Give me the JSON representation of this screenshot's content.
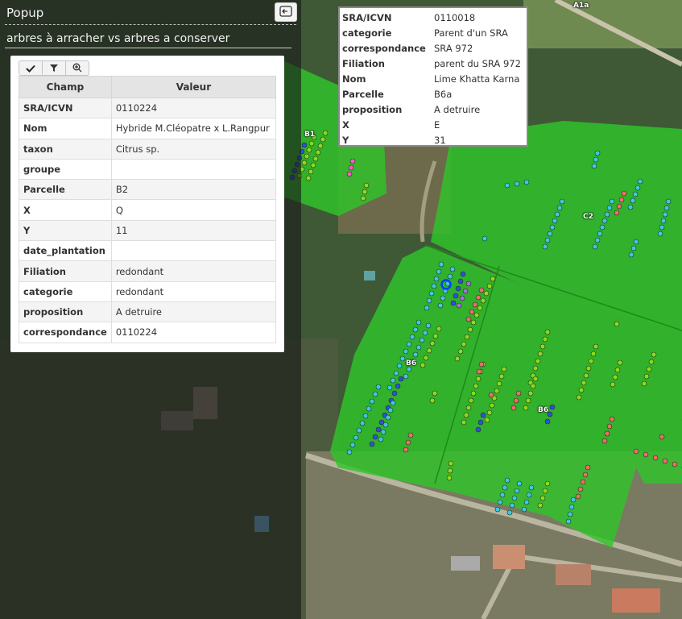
{
  "popup": {
    "title": "Popup",
    "close_icon": "collapse-left-icon",
    "layer_name": "arbres à arracher vs arbres a conserver",
    "toolbar": [
      {
        "name": "check-icon",
        "glyph": "✔"
      },
      {
        "name": "filter-icon",
        "glyph": "⏷"
      },
      {
        "name": "zoom-in-icon",
        "glyph": "⊕"
      }
    ],
    "table": {
      "headers": [
        "Champ",
        "Valeur"
      ],
      "rows": [
        [
          "SRA/ICVN",
          "0110224"
        ],
        [
          "Nom",
          "Hybride M.Cléopatre x L.Rangpur"
        ],
        [
          "taxon",
          "Citrus sp."
        ],
        [
          "groupe",
          ""
        ],
        [
          "Parcelle",
          "B2"
        ],
        [
          "X",
          "Q"
        ],
        [
          "Y",
          "11"
        ],
        [
          "date_plantation",
          ""
        ],
        [
          "Filiation",
          "redondant"
        ],
        [
          "categorie",
          "redondant"
        ],
        [
          "proposition",
          "A detruire"
        ],
        [
          "correspondance",
          "0110224"
        ]
      ]
    }
  },
  "tooltip": {
    "rows": [
      [
        "SRA/ICVN",
        "0110018"
      ],
      [
        "categorie",
        "Parent d'un SRA"
      ],
      [
        "correspondance",
        "SRA 972"
      ],
      [
        "Filiation",
        "parent du SRA 972"
      ],
      [
        "Nom",
        "Lime Khatta Karna"
      ],
      [
        "Parcelle",
        "B6a"
      ],
      [
        "proposition",
        "A detruire"
      ],
      [
        "X",
        "E"
      ],
      [
        "Y",
        "31"
      ]
    ]
  },
  "map": {
    "labels": [
      "A1a",
      "B1",
      "C2",
      "B6",
      "B6"
    ],
    "colors": {
      "parcel_fill": "#2fc42a",
      "cyan_tree": "#3ec6e0",
      "green_tree": "#8fd61c",
      "red_tree": "#f06a6a",
      "blue_tree": "#2f4fe0",
      "purple_tree": "#a86ee0",
      "pink_tree": "#f060c0"
    }
  }
}
